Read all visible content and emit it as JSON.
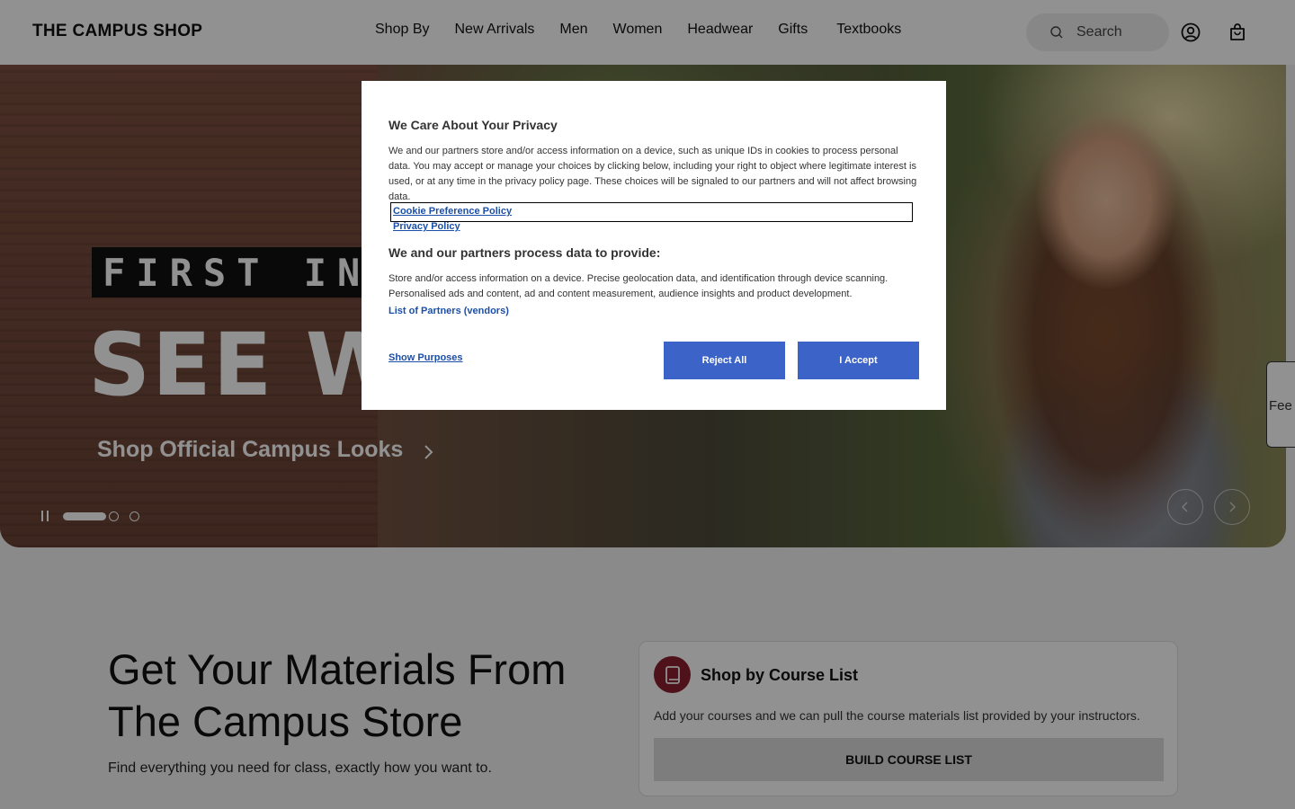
{
  "header": {
    "logo": "THE CAMPUS SHOP",
    "nav": [
      "Shop By",
      "New Arrivals",
      "Men",
      "Women",
      "Headwear",
      "Gifts",
      "Textbooks"
    ],
    "search_placeholder": "Search",
    "icons": [
      "search-icon",
      "account-icon",
      "cart-icon"
    ]
  },
  "hero": {
    "badge_text": "FIRST IN",
    "headline": "SEE W                            W",
    "link": "Shop Official Campus Looks",
    "slide_count": 3,
    "active_slide": 1
  },
  "feedback": {
    "label": "Fee"
  },
  "materials": {
    "title": "Get Your Materials From The Campus Store",
    "subtitle": "Find everything you need for class, exactly how you want to.",
    "card": {
      "title": "Shop by Course List",
      "description": "Add your courses and we can pull the course materials list provided by your instructors.",
      "button": "BUILD COURSE LIST"
    }
  },
  "privacy": {
    "title": "We Care About Your Privacy",
    "body": "We and our partners store and/or access information on a device, such as unique IDs in cookies to process personal data. You may accept or manage your choices by clicking below, including your right to object where legitimate interest is used, or at any time in the privacy policy page. These choices will be signaled to our partners and will not affect browsing data.",
    "cookie_policy_link": "Cookie Preference Policy",
    "privacy_policy_link": "Privacy Policy",
    "subtitle": "We and our partners process data to provide:",
    "body2": "Store and/or access information on a device. Precise geolocation data, and identification through device scanning. Personalised ads and content, ad and content measurement, audience insights and product development.",
    "partners_link": "List of Partners (vendors)",
    "show_purposes": "Show Purposes",
    "reject": "Reject All",
    "accept": "I Accept"
  },
  "colors": {
    "accent_blue": "#3c63c8",
    "link_blue": "#1c4fa8",
    "course_icon_bg": "#8b1e2e"
  }
}
